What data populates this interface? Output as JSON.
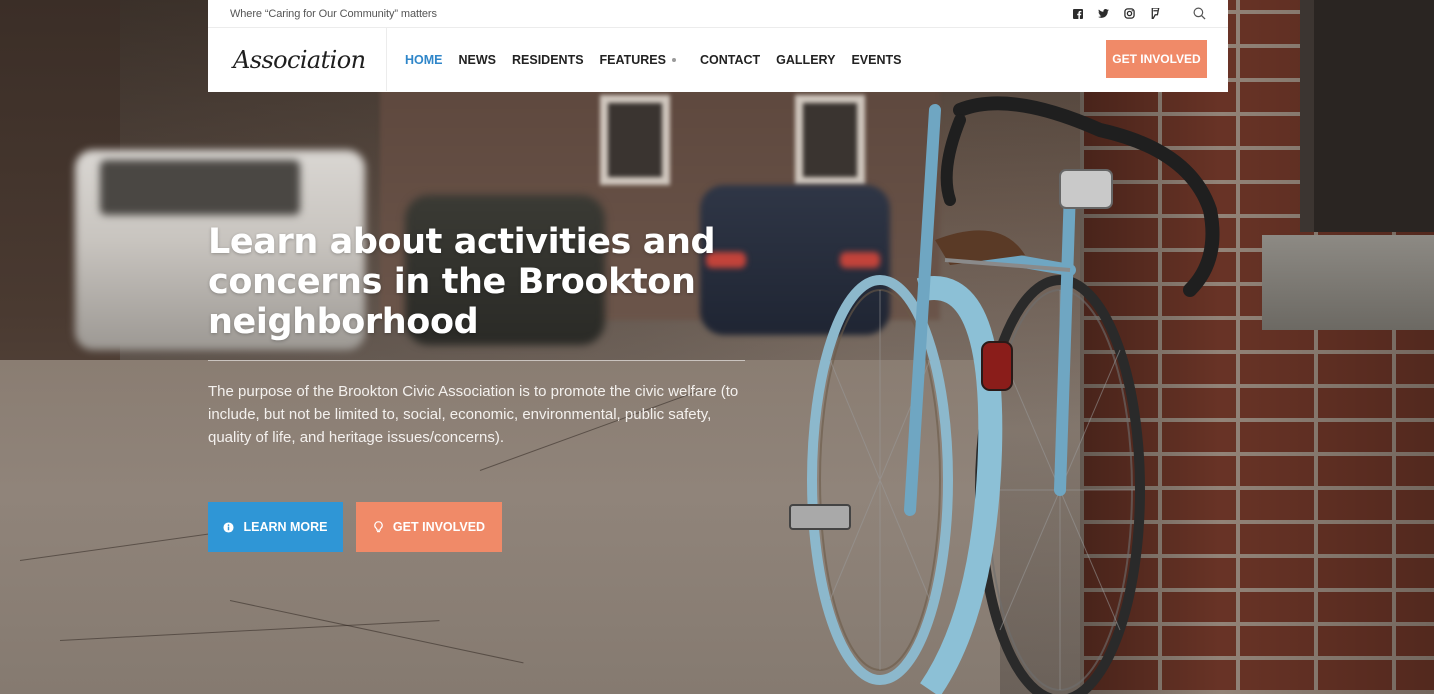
{
  "topbar": {
    "tagline": "Where “Caring for Our Community” matters",
    "icons": [
      "facebook-icon",
      "twitter-icon",
      "instagram-icon",
      "foursquare-icon",
      "search-icon"
    ]
  },
  "navbar": {
    "logo": "Association",
    "items": [
      {
        "label": "HOME",
        "active": true
      },
      {
        "label": "NEWS",
        "active": false
      },
      {
        "label": "RESIDENTS",
        "active": false
      },
      {
        "label": "FEATURES",
        "active": false,
        "has_dropdown": true
      },
      {
        "label": "CONTACT",
        "active": false
      },
      {
        "label": "GALLERY",
        "active": false
      },
      {
        "label": "EVENTS",
        "active": false
      }
    ],
    "cta_label": "GET INVOLVED"
  },
  "hero": {
    "title": "Learn about activities and concerns in the Brookton neighborhood",
    "description": "The purpose of the Brookton Civic Association is to promote the civic welfare (to include, but not be limited to, social, economic, environmental, public safety, quality of life, and heritage issues/concerns).",
    "buttons": {
      "learn_more": {
        "label": "LEARN MORE",
        "icon": "info-icon"
      },
      "get_involved": {
        "label": "GET INVOLVED",
        "icon": "lightbulb-icon"
      }
    }
  },
  "colors": {
    "accent_blue": "#2f96d6",
    "accent_active_nav": "#2f86c9",
    "accent_orange": "#f08a68"
  }
}
